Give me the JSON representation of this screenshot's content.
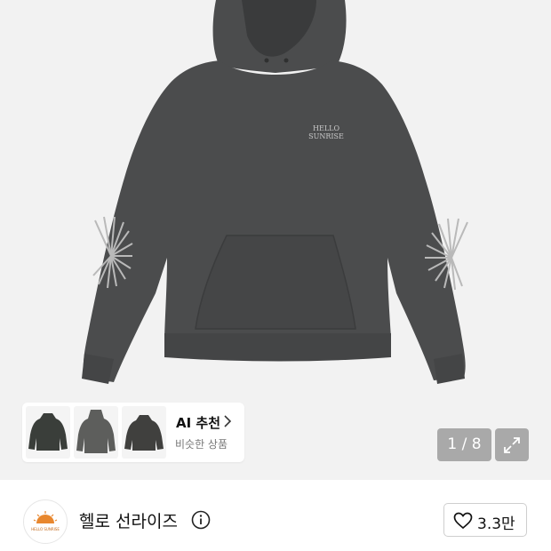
{
  "product": {
    "image_alt_icon": "hoodie-image",
    "print_text_line1": "HELLO",
    "print_text_line2": "SUNRISE"
  },
  "ai_recommend": {
    "title": "AI 추천",
    "subtitle": "비슷한 상품"
  },
  "gallery": {
    "pager": "1 / 8"
  },
  "brand": {
    "name": "헬로 선라이즈",
    "logo_text": "HELLO SUNRISE",
    "like_count": "3.3만"
  },
  "colors": {
    "background": "#f2f2f2",
    "hoodie": "#4b4c4d",
    "hoodie_shadow": "#3d3e3f"
  }
}
